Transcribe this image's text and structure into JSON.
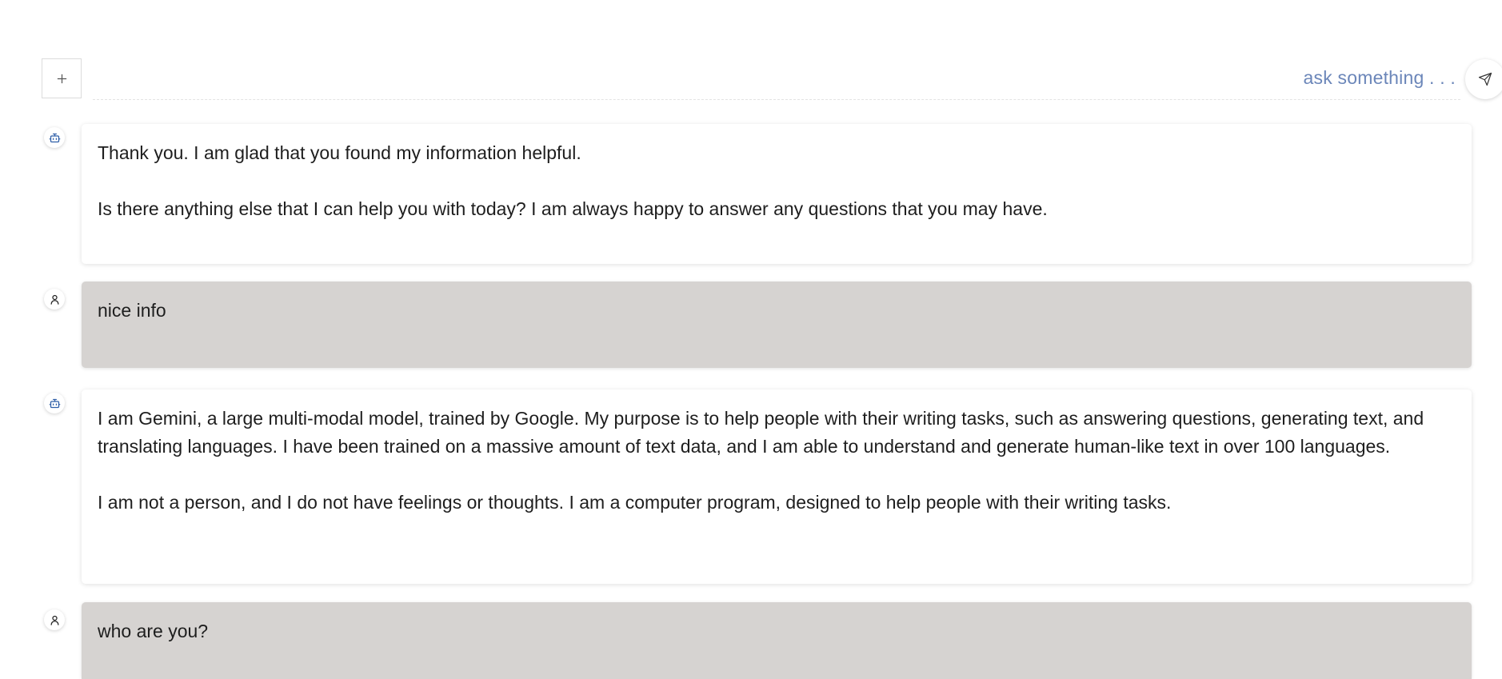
{
  "composer": {
    "placeholder": "ask something . . .",
    "attach_icon": "plus-icon",
    "send_icon": "send-icon"
  },
  "colors": {
    "placeholder": "#6b86b9",
    "user_bubble": "#d6d3d1",
    "bot_bubble": "#ffffff"
  },
  "messages": [
    {
      "role": "bot",
      "icon": "bot-icon",
      "paragraphs": [
        "Thank you. I am glad that you found my information helpful.",
        "Is there anything else that I can help you with today? I am always happy to answer any questions that you may have."
      ]
    },
    {
      "role": "user",
      "icon": "user-icon",
      "paragraphs": [
        "nice info"
      ]
    },
    {
      "role": "bot",
      "icon": "bot-icon",
      "paragraphs": [
        "I am Gemini, a large multi-modal model, trained by Google. My purpose is to help people with their writing tasks, such as answering questions, generating text, and translating languages. I have been trained on a massive amount of text data, and I am able to understand and generate human-like text in over 100 languages.",
        "I am not a person, and I do not have feelings or thoughts. I am a computer program, designed to help people with their writing tasks."
      ]
    },
    {
      "role": "user",
      "icon": "user-icon",
      "paragraphs": [
        "who are you?"
      ]
    }
  ]
}
